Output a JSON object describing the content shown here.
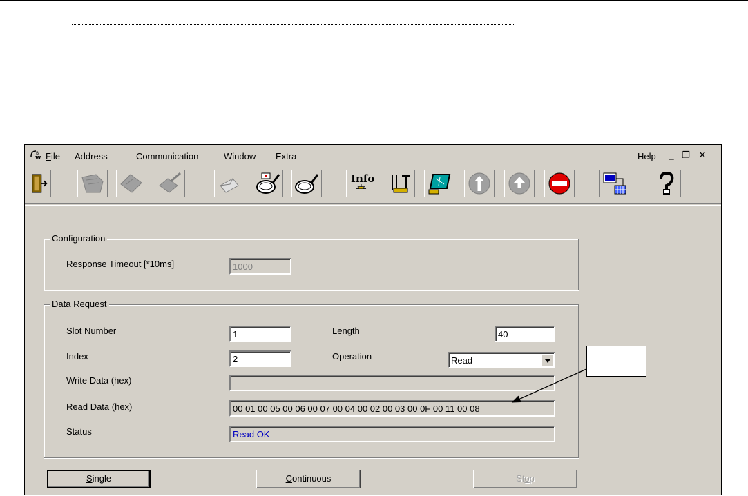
{
  "menu": {
    "file": "File",
    "address": "Address",
    "communication": "Communication",
    "window": "Window",
    "extra": "Extra",
    "help": "Help"
  },
  "window_controls": {
    "minimize": "_",
    "restore": "❐",
    "close": "✕"
  },
  "toolbar": {
    "info_label": "Info",
    "icons": [
      "exit-door-icon",
      "read-device-icon",
      "write-device-icon",
      "edit-device-icon",
      "mail-icon",
      "search-live-icon",
      "search-icon",
      "info-icon",
      "tools-icon",
      "monitor-icon",
      "upload-icon",
      "download-icon",
      "stop-icon",
      "network-config-icon",
      "help-icon"
    ]
  },
  "configuration": {
    "title": "Configuration",
    "response_timeout_label": "Response Timeout [*10ms]",
    "response_timeout_value": "1000"
  },
  "data_request": {
    "title": "Data Request",
    "slot_number_label": "Slot Number",
    "slot_number_value": "1",
    "index_label": "Index",
    "index_value": "2",
    "length_label": "Length",
    "length_value": "40",
    "operation_label": "Operation",
    "operation_value": "Read",
    "write_data_label": "Write Data (hex)",
    "write_data_value": "",
    "read_data_label": "Read Data (hex)",
    "read_data_value": "00 01 00 05 00 06 00 07 00 04 00 02 00 03 00 0F 00 11 00 08",
    "status_label": "Status",
    "status_value": "Read OK"
  },
  "buttons": {
    "single": "Single",
    "continuous": "Continuous",
    "stop": "Stop"
  },
  "colors": {
    "window_bg": "#d4d0c8",
    "status_text": "#0000c0",
    "stop_red": "#e00000"
  }
}
